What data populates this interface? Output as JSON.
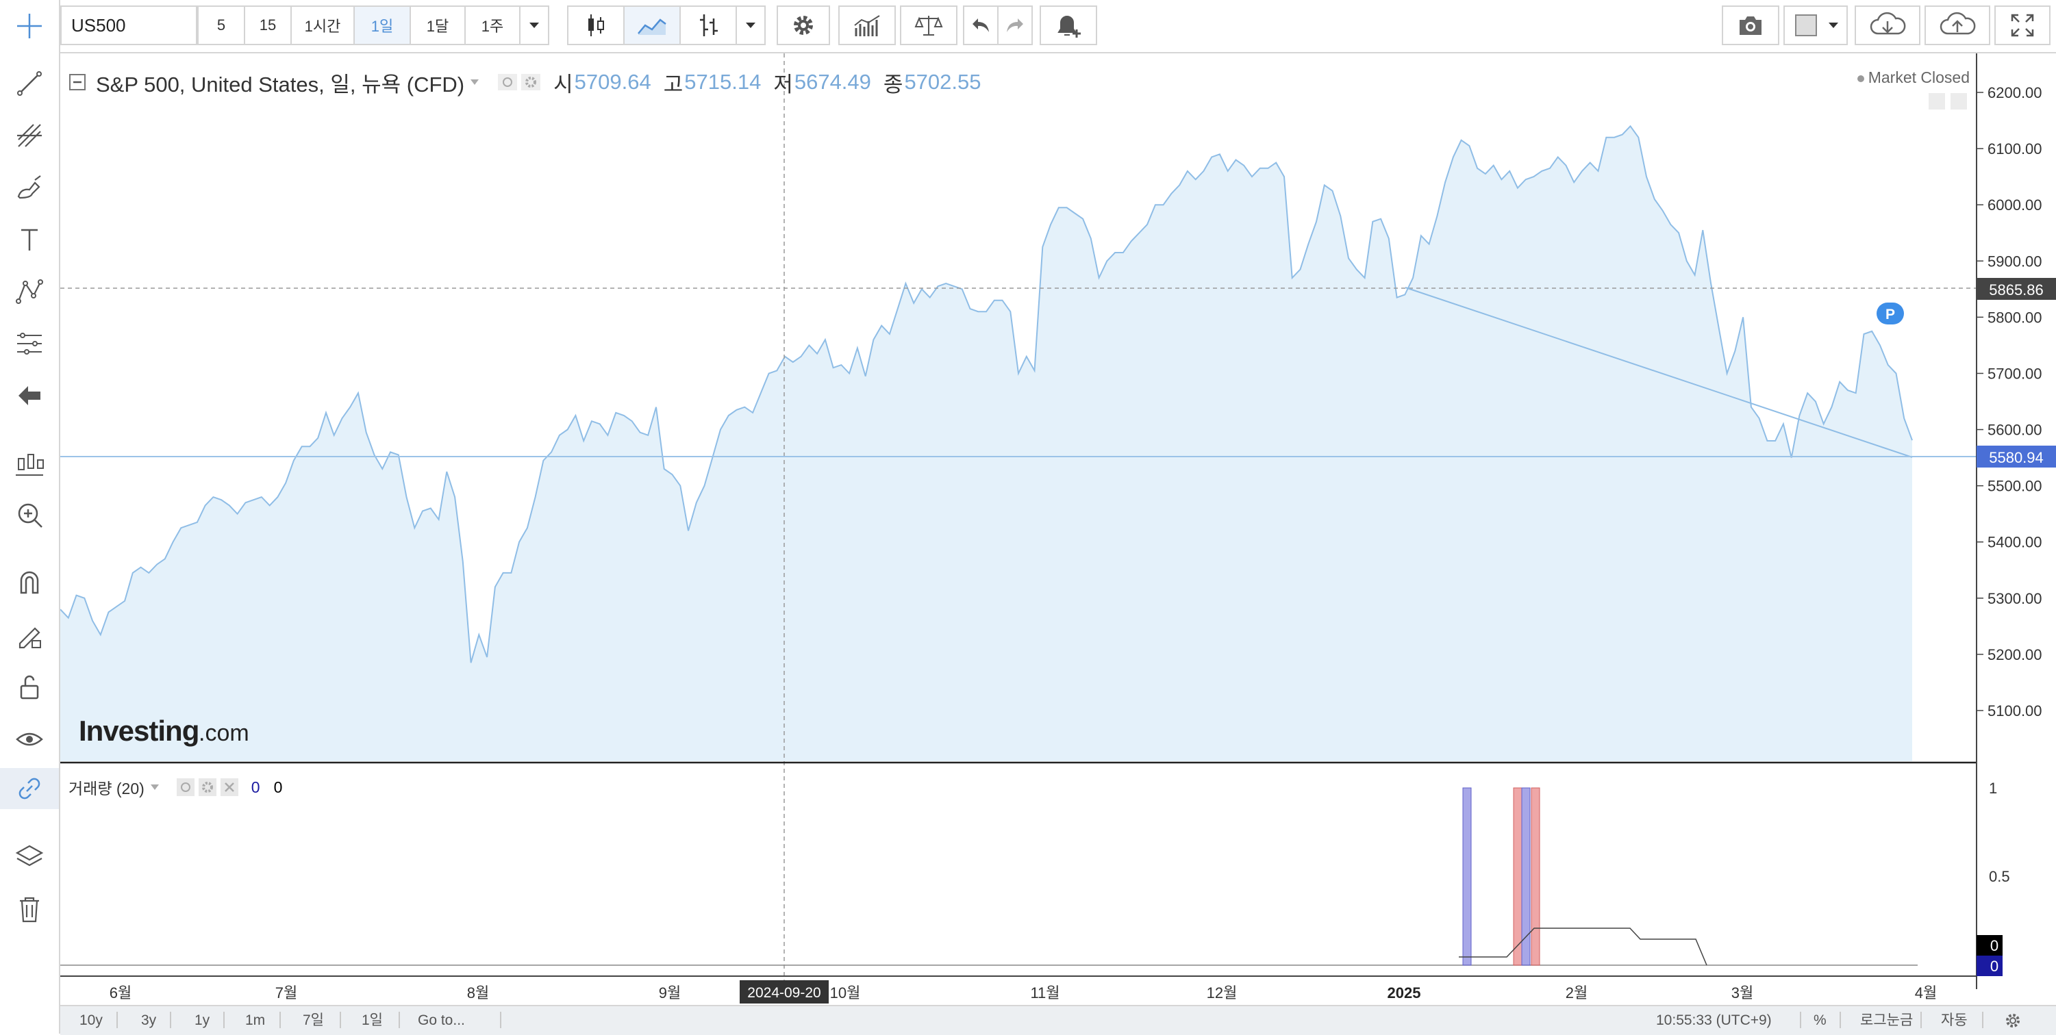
{
  "toolbar": {
    "symbol": "US500",
    "intervals": [
      "5",
      "15",
      "1시간",
      "1일",
      "1달",
      "1주"
    ],
    "active_interval": "1일"
  },
  "legend": {
    "title": "S&P 500, United States, 일, 뉴욕 (CFD)",
    "open_label": "시",
    "open": "5709.64",
    "high_label": "고",
    "high": "5715.14",
    "low_label": "저",
    "low": "5674.49",
    "close_label": "종",
    "close": "5702.55"
  },
  "status": {
    "market": "Market Closed"
  },
  "watermark": {
    "brand": "Investing",
    "suffix": ".com"
  },
  "price_axis": {
    "ticks": [
      "6200.00",
      "6100.00",
      "6000.00",
      "5900.00",
      "5800.00",
      "5700.00",
      "5600.00",
      "5500.00",
      "5400.00",
      "5300.00",
      "5200.00",
      "5100.00"
    ],
    "crosshair_price": "5865.86",
    "last_price": "5580.94"
  },
  "time_axis": {
    "labels": [
      "6월",
      "7월",
      "8월",
      "9월",
      "10월",
      "11월",
      "12월",
      "2025",
      "2월",
      "3월",
      "4월"
    ],
    "crosshair_date": "2024-09-20"
  },
  "volume": {
    "label": "거래량 (20)",
    "value_a": "0",
    "value_b": "0",
    "ticks": [
      "1",
      "0.5"
    ],
    "tag_a": "0",
    "tag_b": "0"
  },
  "marker": {
    "label": "P"
  },
  "bottom": {
    "ranges": [
      "10y",
      "3y",
      "1y",
      "1m",
      "7일",
      "1일"
    ],
    "goto": "Go to...",
    "time": "10:55:33 (UTC+9)",
    "percent": "%",
    "log": "로그눈금",
    "auto": "자동"
  },
  "colors": {
    "line": "#8fbde6",
    "area": "#e4f1fa",
    "accent": "#4f8fd6",
    "last_price_tag": "#4a6fd6",
    "crosshair_tag": "#444444"
  },
  "chart_data": {
    "type": "area",
    "series": [
      {
        "values": [
          5280,
          5265,
          5305,
          5300,
          5260,
          5235,
          5275,
          5285,
          5295,
          5345,
          5355,
          5345,
          5360,
          5370,
          5400,
          5425,
          5430,
          5435,
          5465,
          5480,
          5475,
          5465,
          5450,
          5470,
          5475,
          5480,
          5465,
          5480,
          5505,
          5545,
          5570,
          5570,
          5585,
          5630,
          5590,
          5620,
          5640,
          5665,
          5595,
          5555,
          5530,
          5560,
          5555,
          5480,
          5425,
          5455,
          5460,
          5440,
          5525,
          5480,
          5365,
          5185,
          5235,
          5195,
          5320,
          5345,
          5345,
          5400,
          5425,
          5480,
          5545,
          5560,
          5590,
          5600,
          5625,
          5580,
          5615,
          5610,
          5590,
          5630,
          5625,
          5615,
          5595,
          5590,
          5640,
          5530,
          5520,
          5500,
          5420,
          5470,
          5500,
          5550,
          5600,
          5625,
          5635,
          5640,
          5630,
          5665,
          5700,
          5705,
          5730,
          5720,
          5730,
          5750,
          5735,
          5760,
          5710,
          5715,
          5700,
          5745,
          5695,
          5760,
          5785,
          5770,
          5815,
          5860,
          5825,
          5850,
          5835,
          5855,
          5860,
          5855,
          5850,
          5815,
          5810,
          5810,
          5830,
          5830,
          5810,
          5700,
          5730,
          5705,
          5925,
          5965,
          5995,
          5995,
          5985,
          5975,
          5940,
          5870,
          5900,
          5915,
          5915,
          5935,
          5950,
          5965,
          6000,
          6000,
          6020,
          6035,
          6060,
          6045,
          6060,
          6085,
          6090,
          6060,
          6080,
          6070,
          6050,
          6065,
          6065,
          6075,
          6050,
          5870,
          5885,
          5930,
          5970,
          6035,
          6025,
          5980,
          5905,
          5885,
          5870,
          5970,
          5975,
          5940,
          5835,
          5840,
          5870,
          5945,
          5930,
          5980,
          6040,
          6085,
          6115,
          6105,
          6065,
          6055,
          6070,
          6045,
          6060,
          6030,
          6045,
          6050,
          6060,
          6065,
          6085,
          6070,
          6040,
          6060,
          6075,
          6060,
          6120,
          6120,
          6125,
          6140,
          6120,
          6050,
          6010,
          5990,
          5965,
          5950,
          5900,
          5875,
          5955,
          5860,
          5780,
          5700,
          5740,
          5800,
          5640,
          5620,
          5580,
          5580,
          5610,
          5550,
          5625,
          5665,
          5650,
          5610,
          5640,
          5685,
          5670,
          5665,
          5770,
          5775,
          5750,
          5715,
          5700,
          5620,
          5580.94
        ]
      }
    ],
    "x_start": "2024-05-24",
    "ylim": [
      5060,
      6230
    ],
    "yticks": [
      6200,
      6100,
      6000,
      5900,
      5800,
      5700,
      5600,
      5500,
      5400,
      5300,
      5200,
      5100
    ],
    "volume_bars": [
      {
        "date": "2025-01-22",
        "value": 1,
        "color": "blue"
      },
      {
        "date": "2025-02-13",
        "value": 1,
        "color": "red"
      },
      {
        "date": "2025-02-14",
        "value": 1,
        "color": "blue"
      },
      {
        "date": "2025-02-17",
        "value": 1,
        "color": "red"
      }
    ]
  }
}
